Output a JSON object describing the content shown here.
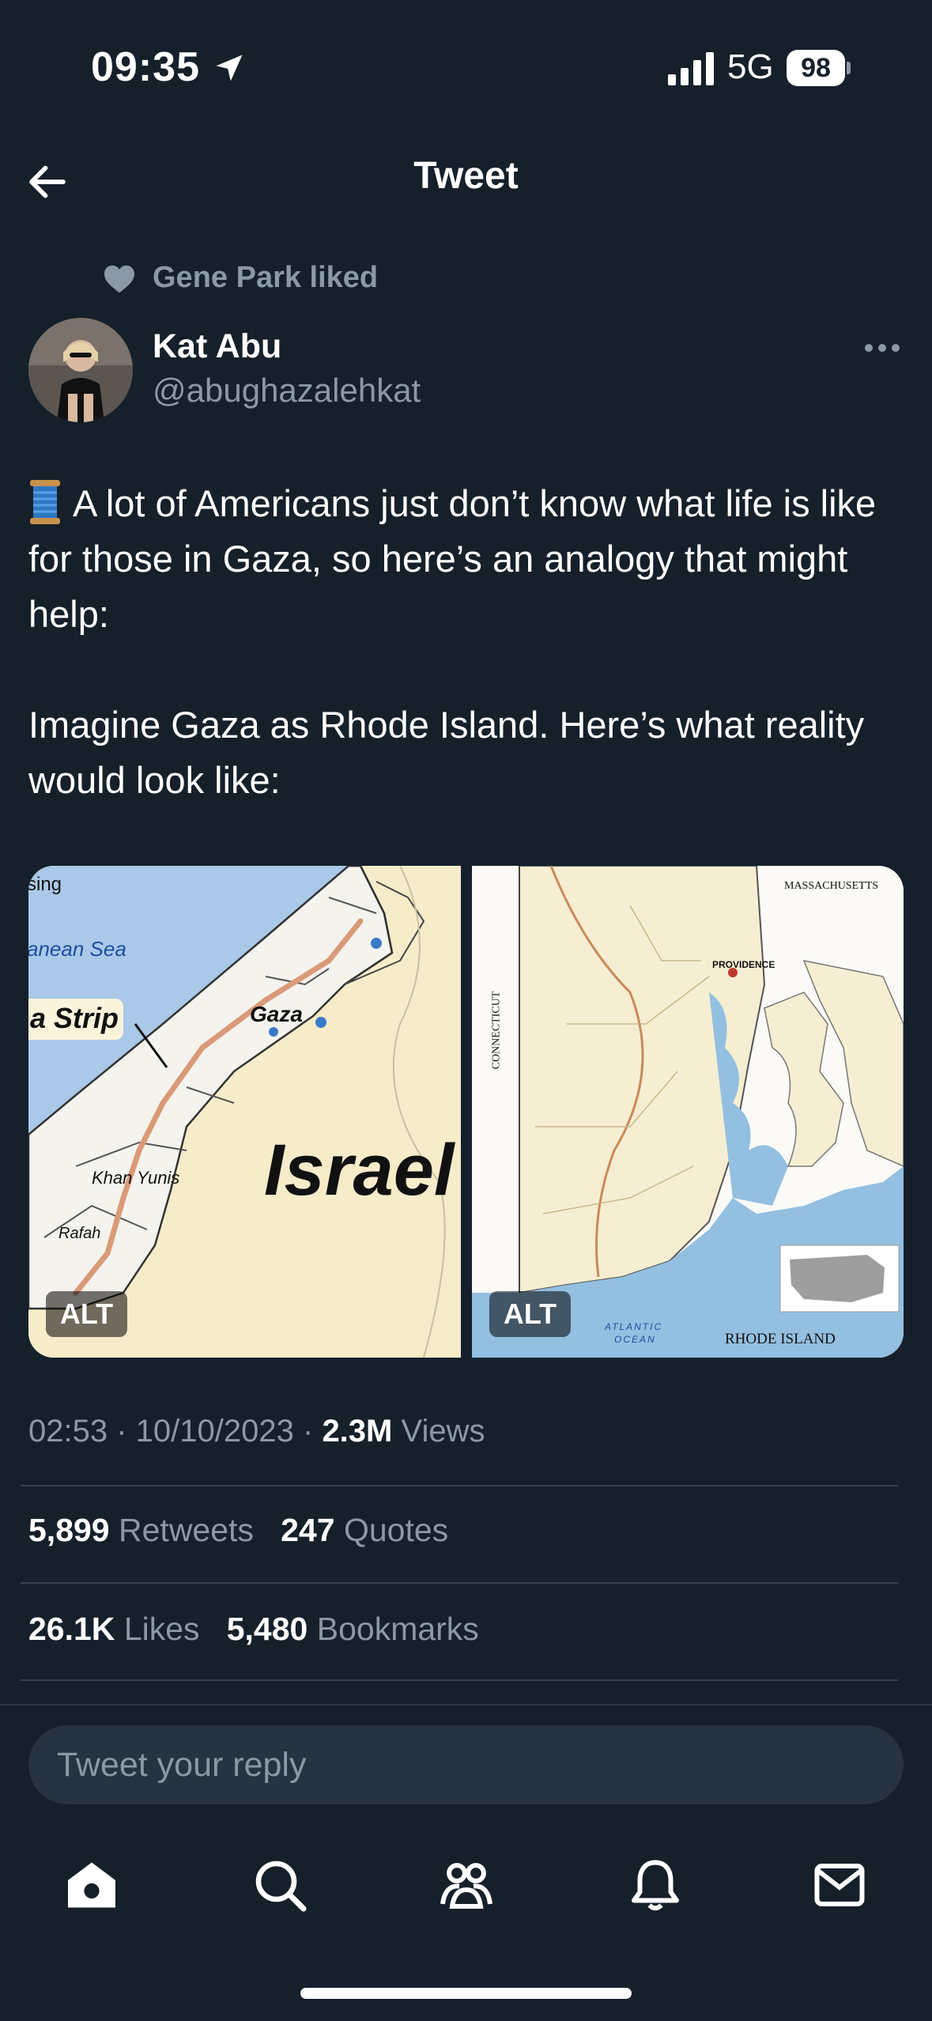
{
  "status_bar": {
    "time": "09:35",
    "network": "5G",
    "battery": "98"
  },
  "header": {
    "title": "Tweet"
  },
  "social_context": {
    "text": "Gene Park liked"
  },
  "author": {
    "name": "Kat Abu",
    "handle": "@abughazalehkat"
  },
  "tweet": {
    "text": "A lot of Americans just don’t know what life is like for those in Gaza, so here’s an analogy that might help:\n\nImagine Gaza as Rhode Island. Here’s what reality would look like:"
  },
  "media": {
    "left": {
      "alt": "ALT",
      "labels": {
        "top": "sing",
        "sea": "anean Sea",
        "strip": "a Strip",
        "gaza": "Gaza",
        "israel": "Israel",
        "khan_yunis": "Khan Yunis",
        "rafah": "Rafah"
      }
    },
    "right": {
      "alt": "ALT",
      "labels": {
        "massachusetts": "MASSACHUSETTS",
        "connecticut": "CONNECTICUT",
        "providence": "PROVIDENCE",
        "atlantic": "ATLANTIC",
        "ocean": "OCEAN",
        "rhode_island": "RHODE ISLAND"
      }
    }
  },
  "meta": {
    "time": "02:53",
    "date": "10/10/2023",
    "views_count": "2.3M",
    "views_label": "Views"
  },
  "stats": {
    "retweets_count": "5,899",
    "retweets_label": "Retweets",
    "quotes_count": "247",
    "quotes_label": "Quotes",
    "likes_count": "26.1K",
    "likes_label": "Likes",
    "bookmarks_count": "5,480",
    "bookmarks_label": "Bookmarks"
  },
  "reply": {
    "placeholder": "Tweet your reply"
  },
  "tabbar": {
    "icons": [
      "home-icon",
      "search-icon",
      "communities-icon",
      "notifications-icon",
      "messages-icon"
    ]
  },
  "colors": {
    "background": "#15202b",
    "secondary_text": "#8b98a5",
    "divider": "#38444d",
    "input_bg": "#273340"
  }
}
